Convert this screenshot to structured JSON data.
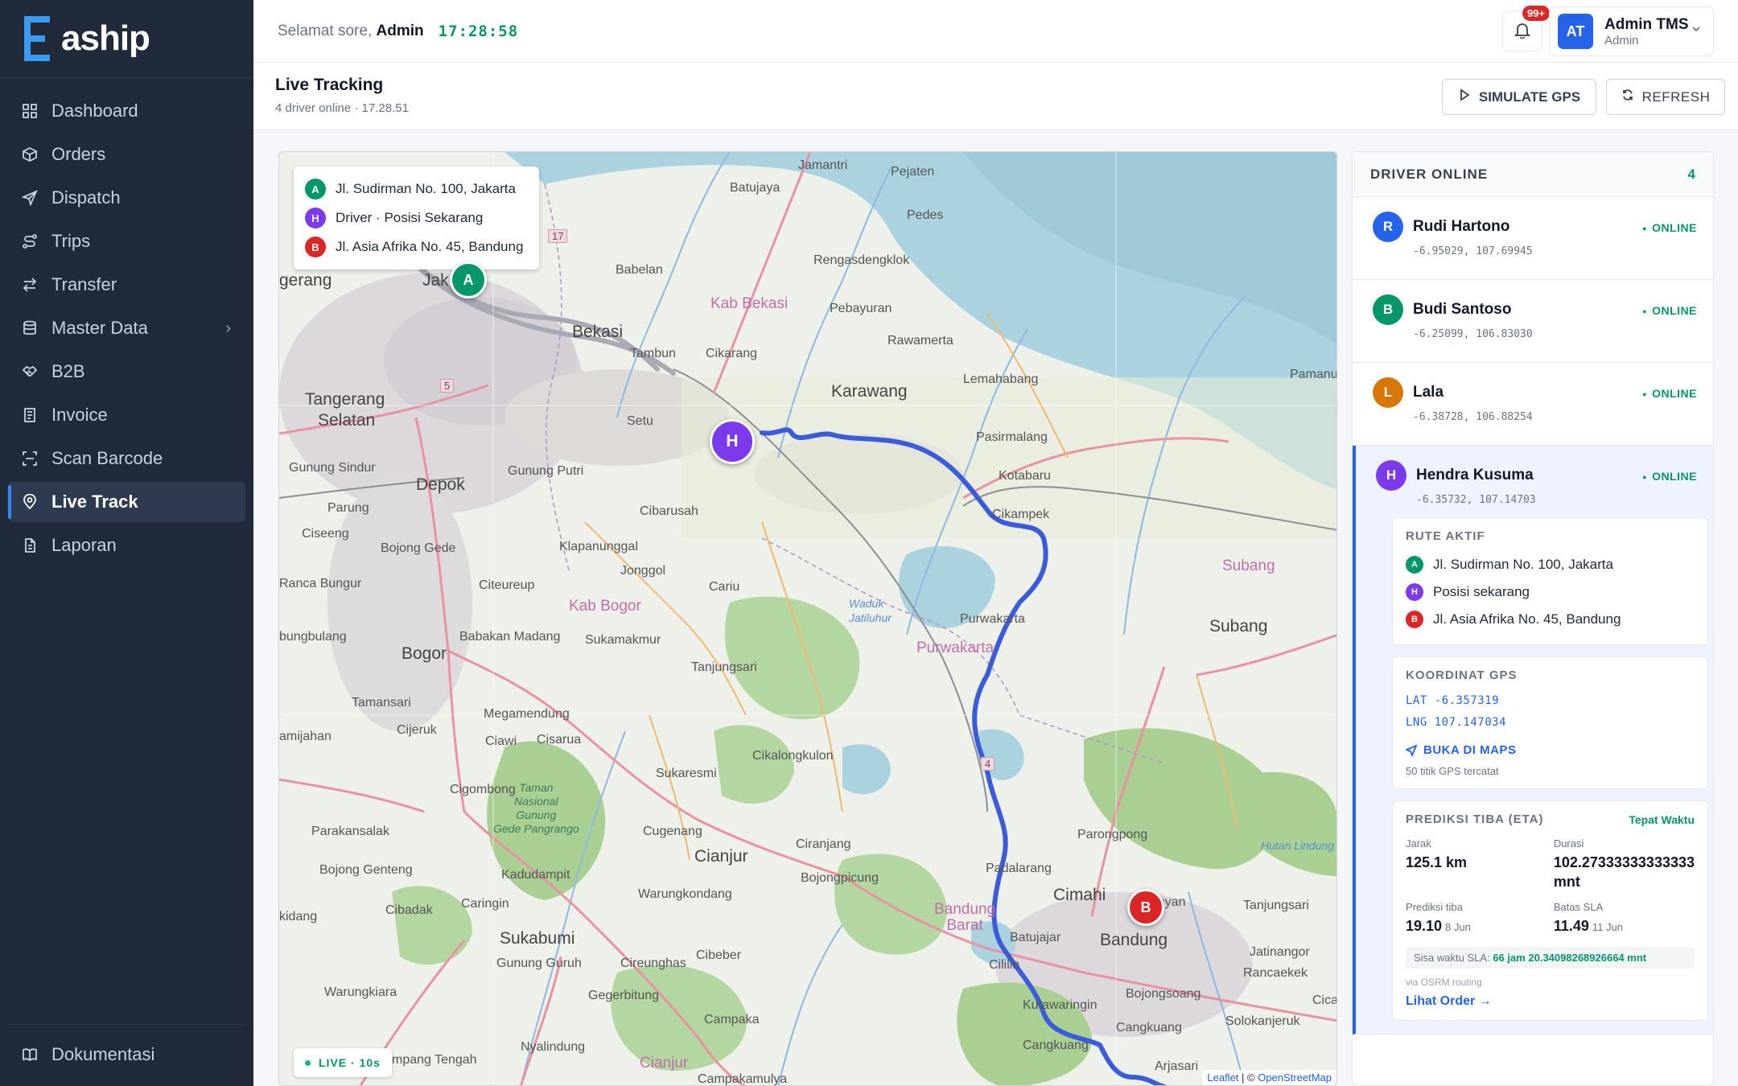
{
  "brand": {
    "logo_text": "aship",
    "accent": "#3b9bf0"
  },
  "sidebar": {
    "items": [
      {
        "label": "Dashboard",
        "icon": "grid-icon"
      },
      {
        "label": "Orders",
        "icon": "box-icon"
      },
      {
        "label": "Dispatch",
        "icon": "send-icon"
      },
      {
        "label": "Trips",
        "icon": "route-icon"
      },
      {
        "label": "Transfer",
        "icon": "transfer-icon"
      },
      {
        "label": "Master Data",
        "icon": "database-icon"
      },
      {
        "label": "B2B",
        "icon": "handshake-icon"
      },
      {
        "label": "Invoice",
        "icon": "invoice-icon"
      },
      {
        "label": "Scan Barcode",
        "icon": "scan-icon"
      },
      {
        "label": "Live Track",
        "icon": "map-pin-icon",
        "active": true
      },
      {
        "label": "Laporan",
        "icon": "document-icon"
      }
    ],
    "docs_label": "Dokumentasi"
  },
  "header": {
    "greeting": "Selamat sore,",
    "user_first": "Admin",
    "clock": "17:28:58",
    "notif_badge": "99+",
    "avatar_initials": "AT",
    "user_name": "Admin TMS",
    "user_role": "Admin"
  },
  "page": {
    "title": "Live Tracking",
    "subtitle": "4 driver online · 17.28.51",
    "simulate_label": "SIMULATE GPS",
    "refresh_label": "REFRESH"
  },
  "map": {
    "legend": [
      {
        "letter": "A",
        "text": "Jl. Sudirman No. 100, Jakarta",
        "color": "#059669"
      },
      {
        "letter": "H",
        "text": "Driver · Posisi Sekarang",
        "color": "#7c3aed"
      },
      {
        "letter": "B",
        "text": "Jl. Asia Afrika No. 45, Bandung",
        "color": "#dc2626"
      }
    ],
    "live_badge": "LIVE · 10s",
    "attribution_leaflet": "Leaflet",
    "attribution_sep": " | © ",
    "attribution_osm": "OpenStreetMap",
    "labels": {
      "jamantri": "Jamantri",
      "pejaten": "Pejaten",
      "batujaya": "Batujaya",
      "pedes": "Pedes",
      "jakarta": "Jak",
      "jerang": "gerang",
      "babelan": "Babelan",
      "kab_bekasi": "Kab Bekasi",
      "rengasdengklok": "Rengasdengklok",
      "bekasi": "Bekasi",
      "pebayuran": "Pebayuran",
      "tambun": "Tambun",
      "cikarang": "Cikarang",
      "rawamerta": "Rawamerta",
      "pamanu": "Pamanu",
      "tangerang": "Tangerang",
      "selatan": "Selatan",
      "setu": "Setu",
      "karawang": "Karawang",
      "lemahabang": "Lemahabang",
      "pasirmalang": "Pasirmalang",
      "gunung_sindur": "Gunung Sindur",
      "depok": "Depok",
      "gunung_putri": "Gunung Putri",
      "kotabaru": "Kotabaru",
      "parung": "Parung",
      "cibarusah": "Cibarusah",
      "cikampek": "Cikampek",
      "ciseeng": "Ciseeng",
      "bojong_gede": "Bojong Gede",
      "klapanunggal": "Klapanunggal",
      "subang_region": "Subang",
      "ranca_bungur": "Ranca Bungur",
      "jonggol": "Jonggol",
      "citeureup": "Citeureup",
      "cariu": "Cariu",
      "kab_bogor": "Kab Bogor",
      "purwakarta": "Purwakarta",
      "purwakarta_region": "Purwakarta",
      "subang": "Subang",
      "bungbulang": "bungbulang",
      "babakan_madang": "Babakan Madang",
      "sukamakmur": "Sukamakmur",
      "waduk": "Waduk\nJatiluhur",
      "bogor": "Bogor",
      "tanjungsari": "Tanjungsari",
      "tamansari": "Tamansari",
      "megamendung": "Megamendung",
      "cijeruk": "Cijeruk",
      "ciawi": "Ciawi",
      "cisarua": "Cisarua",
      "amijahan": "amijahan",
      "cikalongkulon": "Cikalongkulon",
      "sukaresmi": "Sukaresmi",
      "cigombong": "Cigombong",
      "taman_nasional": "Taman\nNasional\nGunung\nGede Pangrango",
      "parakansalak": "Parakansalak",
      "cugenang": "Cugenang",
      "cianjur": "Cianjur",
      "ciranjang": "Ciranjang",
      "parongpong": "Parongpong",
      "hutan": "Hutan Lindung",
      "bojong_genteng": "Bojong Genteng",
      "kadudampit": "Kadudampit",
      "bojongpicung": "Bojongpicung",
      "padalarang": "Padalarang",
      "warungkondang": "Warungkondang",
      "cimahi": "Cimahi",
      "cimenyan": "imenyan",
      "cibadak": "Cibadak",
      "caringin": "Caringin",
      "kidang": "kidang",
      "bandung_barat": "Bandung\nBarat",
      "batujajar": "Batujajar",
      "tanjungsari2": "Tanjungsari",
      "sukabumi": "Sukabumi",
      "bandung": "Bandung",
      "jatinangor": "Jatinangor",
      "gunung_guruh": "Gunung Guruh",
      "cibeber": "Cibeber",
      "cireunghas": "Cireunghas",
      "cililin": "Cililin",
      "rancaekek": "Rancaekek",
      "warungkiara": "Warungkiara",
      "gegerbitung": "Gegerbitung",
      "kutawaringin": "Kutawaringin",
      "bojongsoang": "Bojongsoang",
      "cicalengka": "Cical",
      "campaka": "Campaka",
      "solokanjeruk": "Solokanjeruk",
      "nyalindung": "Nyalindung",
      "cangkuang": "Cangkuang",
      "pangalengan_t": "mpang Tengah",
      "campakamulya": "Campakamulya",
      "arjasari": "Arjasari",
      "cianjur_small": "Cianjur",
      "r17": "17",
      "r5": "5",
      "r4": "4"
    }
  },
  "panel": {
    "title": "DRIVER ONLINE",
    "count": "4",
    "drivers": [
      {
        "initial": "R",
        "name": "Rudi Hartono",
        "status": "ONLINE",
        "coord": "-6.95029, 107.69945",
        "color": "#2563eb"
      },
      {
        "initial": "B",
        "name": "Budi Santoso",
        "status": "ONLINE",
        "coord": "-6.25099, 106.83030",
        "color": "#059669"
      },
      {
        "initial": "L",
        "name": "Lala",
        "status": "ONLINE",
        "coord": "-6.38728, 106.88254",
        "color": "#d97706"
      },
      {
        "initial": "H",
        "name": "Hendra Kusuma",
        "status": "ONLINE",
        "coord": "-6.35732, 107.14703",
        "color": "#7c3aed"
      }
    ],
    "route": {
      "title": "RUTE AKTIF",
      "items": [
        {
          "letter": "A",
          "text": "Jl. Sudirman No. 100, Jakarta"
        },
        {
          "letter": "H",
          "text": "Posisi sekarang"
        },
        {
          "letter": "B",
          "text": "Jl. Asia Afrika No. 45, Bandung"
        }
      ]
    },
    "gps": {
      "title": "KOORDINAT GPS",
      "lat": "LAT -6.357319",
      "lng": "LNG 107.147034",
      "maps_link": "BUKA DI MAPS",
      "count_text": "50 titik GPS tercatat"
    },
    "eta": {
      "title": "PREDIKSI TIBA (ETA)",
      "badge": "Tepat Waktu",
      "jarak_label": "Jarak",
      "jarak_value": "125.1 km",
      "durasi_label": "Durasi",
      "durasi_value": "102.27333333333333 mnt",
      "tiba_label": "Prediksi tiba",
      "tiba_value": "19.10",
      "tiba_date": "8 Jun",
      "sla_label": "Batas SLA",
      "sla_value": "11.49",
      "sla_date": "11 Jun",
      "sisa_label": "Sisa waktu SLA:",
      "sisa_value": "66 jam 20.34098268926664 mnt",
      "osrm": "via OSRM routing",
      "link": "Lihat Order →"
    }
  }
}
